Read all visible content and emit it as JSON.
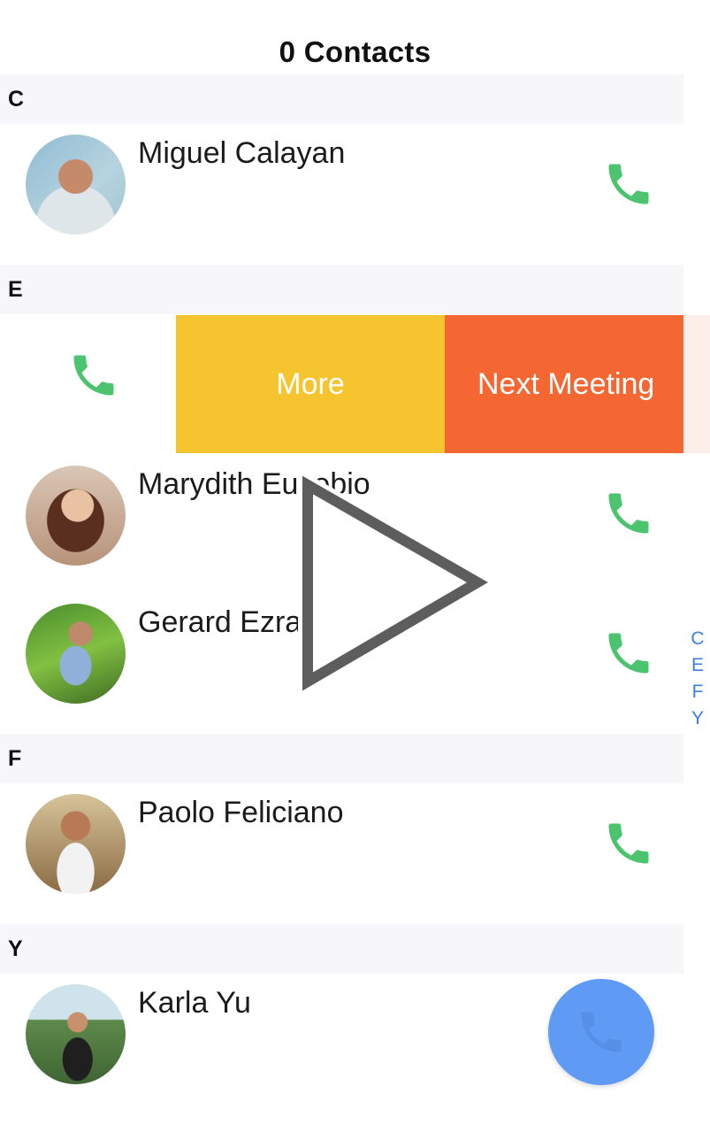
{
  "header": {
    "title": "0 Contacts"
  },
  "sections": {
    "c": {
      "letter": "C"
    },
    "e": {
      "letter": "E"
    },
    "f": {
      "letter": "F"
    },
    "y": {
      "letter": "Y"
    }
  },
  "contacts": {
    "miguel": {
      "name": "Miguel Calayan"
    },
    "marydith": {
      "name": "Marydith Eusebio"
    },
    "gerard": {
      "name": "Gerard Ezra"
    },
    "paolo": {
      "name": "Paolo Feliciano"
    },
    "karla": {
      "name": "Karla Yu"
    }
  },
  "swipe_actions": {
    "more_label": "More",
    "next_meeting_label": "Next Meeting",
    "more_color": "#f6c42e",
    "next_meeting_color": "#f56732"
  },
  "index_bar": {
    "letters": [
      "C",
      "E",
      "F",
      "Y"
    ]
  },
  "icons": {
    "call": "phone-icon",
    "fab": "phone-icon",
    "overlay": "play-icon"
  },
  "colors": {
    "call_green": "#4cc46f",
    "fab_blue": "#5f9bf5",
    "index_blue": "#3d7ee0",
    "section_bg": "#f7f6f9"
  }
}
